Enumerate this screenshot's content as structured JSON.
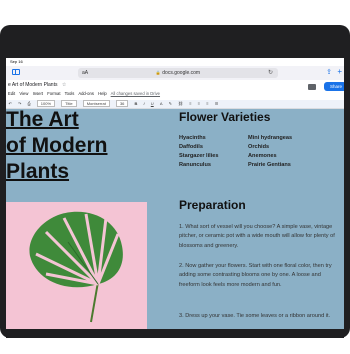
{
  "status_bar": {
    "time": "Sep 16"
  },
  "browser": {
    "aa_label": "aA",
    "url": "docs.google.com",
    "lock_glyph": "🔒",
    "reload_glyph": "↻",
    "share_glyph": "⇪",
    "plus_glyph": "+"
  },
  "docs": {
    "title": "e Art of Modern Plants",
    "menus": [
      "Edit",
      "View",
      "Insert",
      "Format",
      "Tools",
      "Add-ons",
      "Help"
    ],
    "saved_status": "All changes saved in Drive",
    "share_label": "Share",
    "toolbar": {
      "zoom": "100%",
      "style": "Title",
      "font": "Montserrat",
      "size": "36",
      "bold": "B",
      "italic": "I",
      "underline": "U",
      "text_color": "A"
    }
  },
  "document": {
    "title_line1": "The Art",
    "title_line2": "of Modern",
    "title_line3": "Plants",
    "varieties_heading": "Flower Varieties",
    "varieties_col1": [
      "Hyacinths",
      "Daffodils",
      "Stargazer lilies",
      "Ranunculus"
    ],
    "varieties_col2": [
      "Mini hydrangeas",
      "Orchids",
      "Anemones",
      "Prairie Gentians"
    ],
    "preparation_heading": "Preparation",
    "paragraphs": [
      "1. What sort of vessel will you choose? A simple vase, vintage pitcher, or ceramic pot with a wide mouth will allow for plenty of blossoms and greenery.",
      "2. Now gather your flowers. Start with one floral color, then try adding some contrasting blooms one by one. A loose and freeform look feels more modern and fun.",
      "3. Dress up your vase. Tie some leaves or a ribbon around it."
    ]
  },
  "colors": {
    "page_bg": "#8bb0c6",
    "photo_bg": "#f4c4d4",
    "leaf": "#3f8a3a",
    "accent": "#1a73e8"
  }
}
